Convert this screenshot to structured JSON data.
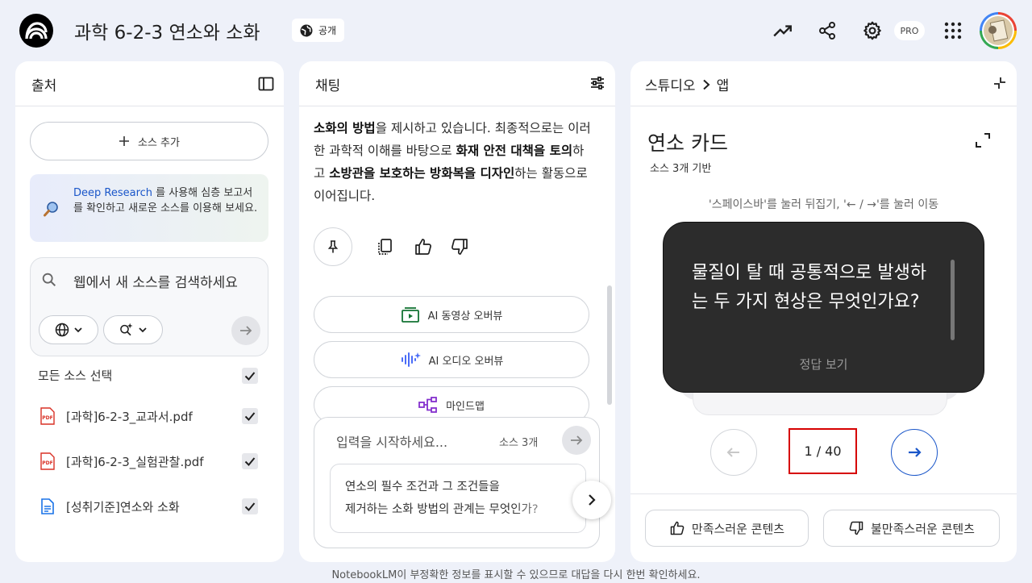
{
  "header": {
    "notebook_title": "과학 6-2-3 연소와 소화",
    "public_label": "공개",
    "pro_label": "PRO"
  },
  "sources": {
    "title": "출처",
    "add_source": "소스 추가",
    "deep_research_link": "Deep Research",
    "deep_research_text": " 를 사용해 심층 보고서를 확인하고 새로운 소스를 이용해 보세요.",
    "search_placeholder": "웹에서 새 소스를 검색하세요",
    "select_all": "모든 소스 선택",
    "items": [
      {
        "name": "[과학]6-2-3_교과서.pdf",
        "type": "pdf-icon",
        "checked": true
      },
      {
        "name": "[과학]6-2-3_실험관찰.pdf",
        "type": "pdf-icon",
        "checked": true
      },
      {
        "name": "[성취기준]연소와 소화",
        "type": "doc-icon",
        "checked": true
      }
    ]
  },
  "chat": {
    "title": "채팅",
    "message": {
      "p1_bold": "소화의 방법",
      "p1": "을 제시하고 있습니다. 최종적으로는 이러한 과학적 이해를 바탕으로 ",
      "p2_bold": "화재 안전 대책을 토의",
      "p2": "하고 ",
      "p3_bold": "소방관을 보호하는 방화복을 디자인",
      "p3": "하는 활동으로 이어집니다."
    },
    "suggestions": [
      {
        "label": "AI 동영상 오버뷰",
        "icon": "video-icon"
      },
      {
        "label": "AI 오디오 오버뷰",
        "icon": "audio-icon"
      },
      {
        "label": "마인드맵",
        "icon": "mindmap-icon"
      }
    ],
    "composer_placeholder": "입력을 시작하세요...",
    "source_count": "소스 3개",
    "suggested_question": {
      "line1": "연소의 필수 조건과 그 조건들을",
      "line2": "제거하는 소화 방법의 관계는 무엇인가?"
    }
  },
  "studio": {
    "breadcrumb_root": "스튜디오",
    "breadcrumb_leaf": "앱",
    "title": "연소 카드",
    "subtitle": "소스 3개 기반",
    "hint": "'스페이스바'를 눌러 뒤집기, '← / →'를 눌러 이동",
    "card_question": "물질이 탈 때 공통적으로 발생하는 두 가지 현상은 무엇인가요?",
    "card_answer_label": "정답 보기",
    "counter": "1 / 40",
    "good_feedback": "만족스러운 콘텐츠",
    "bad_feedback": "불만족스러운 콘텐츠"
  },
  "footer": {
    "disclaimer": "NotebookLM이 부정확한 정보를 표시할 수 있으므로 대답을 다시 한번 확인하세요."
  },
  "colors": {
    "background": "#eef1f9",
    "accent_blue": "#1a56c9",
    "pdf_red": "#d93025",
    "doc_blue": "#1a73e8",
    "flashcard": "#2c2c2c",
    "highlight_red": "#d60000"
  }
}
